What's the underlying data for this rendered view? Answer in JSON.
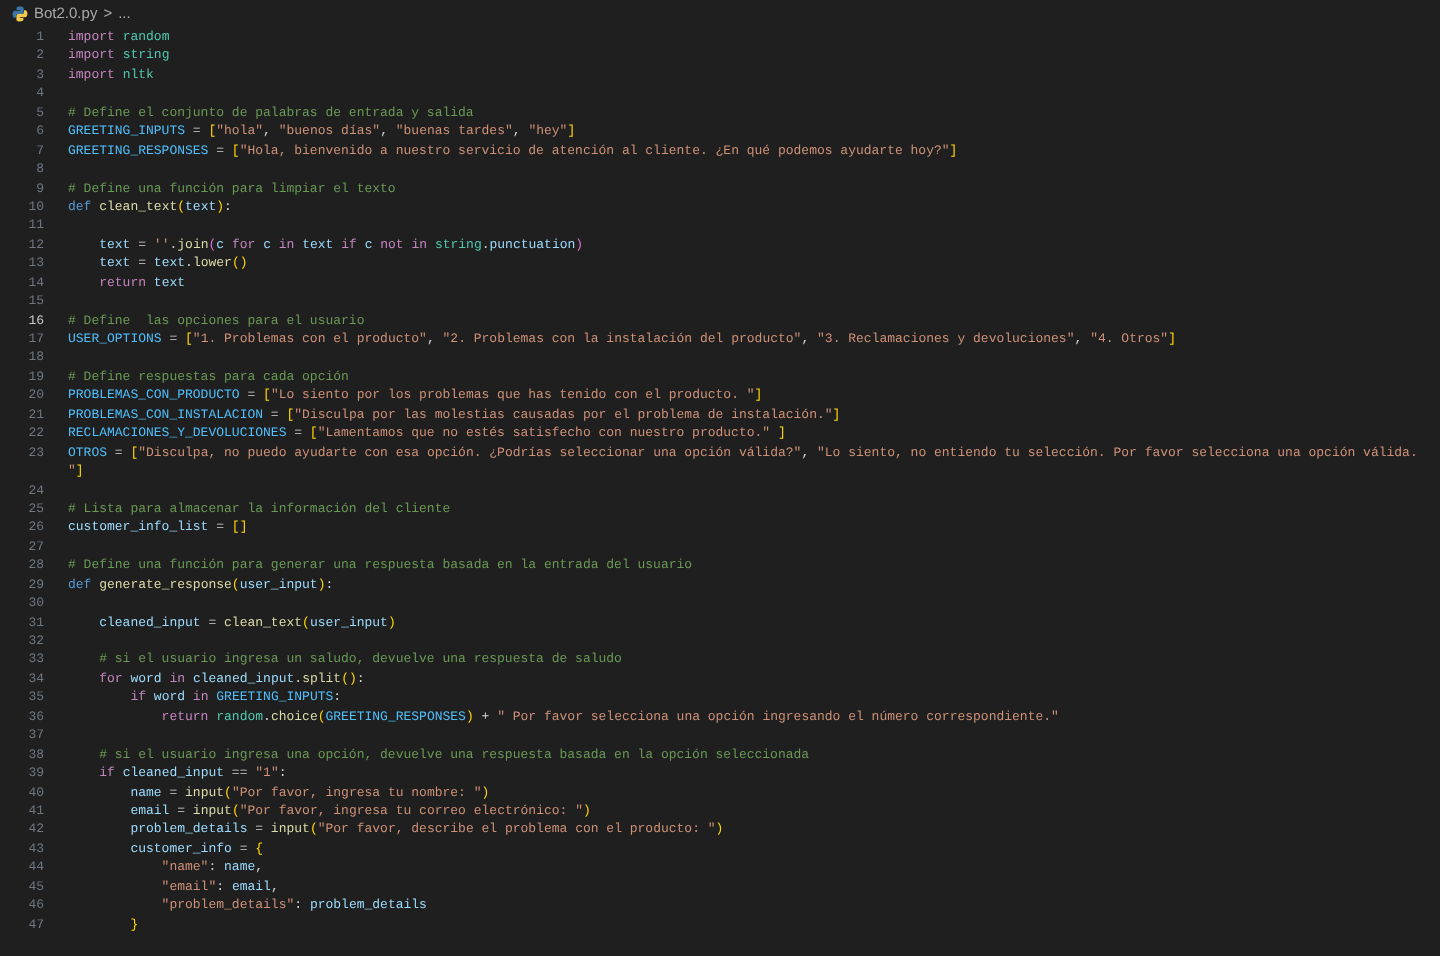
{
  "breadcrumb": {
    "file": "Bot2.0.py",
    "separator": ">",
    "more": "..."
  },
  "lines": [
    {
      "number": "1",
      "current": false,
      "tokens": [
        {
          "kind": "kw",
          "text": "import "
        },
        {
          "kind": "mod",
          "text": "random"
        }
      ]
    },
    {
      "number": "2",
      "current": false,
      "tokens": [
        {
          "kind": "kw",
          "text": "import "
        },
        {
          "kind": "mod",
          "text": "string"
        }
      ]
    },
    {
      "number": "3",
      "current": false,
      "tokens": [
        {
          "kind": "kw",
          "text": "import "
        },
        {
          "kind": "mod",
          "text": "nltk"
        }
      ]
    },
    {
      "number": "4",
      "current": false
    },
    {
      "number": "5",
      "current": false,
      "tokens": [
        {
          "kind": "com",
          "text": "# Define el conjunto de palabras de entrada y salida"
        }
      ]
    },
    {
      "number": "6",
      "current": false,
      "tokens": [
        {
          "kind": "const",
          "text": "GREETING_INPUTS"
        },
        {
          "kind": "op",
          "text": " = "
        },
        {
          "kind": "b1",
          "text": "["
        },
        {
          "kind": "str",
          "text": "\"hola\""
        },
        {
          "kind": "op",
          "text": ", "
        },
        {
          "kind": "str",
          "text": "\"buenos días\""
        },
        {
          "kind": "op",
          "text": ", "
        },
        {
          "kind": "str",
          "text": "\"buenas tardes\""
        },
        {
          "kind": "op",
          "text": ", "
        },
        {
          "kind": "str",
          "text": "\"hey\""
        },
        {
          "kind": "b1",
          "text": "]"
        }
      ]
    },
    {
      "number": "7",
      "current": false,
      "tokens": [
        {
          "kind": "const",
          "text": "GREETING_RESPONSES"
        },
        {
          "kind": "op",
          "text": " = "
        },
        {
          "kind": "b1",
          "text": "["
        },
        {
          "kind": "str",
          "text": "\"Hola, bienvenido a nuestro servicio de atención al cliente. ¿En qué podemos ayudarte hoy?\""
        },
        {
          "kind": "b1",
          "text": "]"
        }
      ]
    },
    {
      "number": "8",
      "current": false
    },
    {
      "number": "9",
      "current": false,
      "tokens": [
        {
          "kind": "com",
          "text": "# Define una función para limpiar el texto"
        }
      ]
    },
    {
      "number": "10",
      "current": false,
      "tokens": [
        {
          "kind": "def",
          "text": "def "
        },
        {
          "kind": "fn",
          "text": "clean_text"
        },
        {
          "kind": "b1",
          "text": "("
        },
        {
          "kind": "var",
          "text": "text"
        },
        {
          "kind": "b1",
          "text": ")"
        },
        {
          "kind": "op",
          "text": ":"
        }
      ]
    },
    {
      "number": "11",
      "current": false
    },
    {
      "number": "12",
      "current": false,
      "tokens": [
        {
          "kind": "var",
          "text": "    text"
        },
        {
          "kind": "op",
          "text": " = "
        },
        {
          "kind": "str",
          "text": "''"
        },
        {
          "kind": "op",
          "text": "."
        },
        {
          "kind": "fn",
          "text": "join"
        },
        {
          "kind": "b2",
          "text": "("
        },
        {
          "kind": "var",
          "text": "c"
        },
        {
          "kind": "kw",
          "text": " for "
        },
        {
          "kind": "var",
          "text": "c"
        },
        {
          "kind": "kw",
          "text": " in "
        },
        {
          "kind": "var",
          "text": "text"
        },
        {
          "kind": "kw",
          "text": " if "
        },
        {
          "kind": "var",
          "text": "c"
        },
        {
          "kind": "kw",
          "text": " not in "
        },
        {
          "kind": "mod",
          "text": "string"
        },
        {
          "kind": "op",
          "text": "."
        },
        {
          "kind": "var",
          "text": "punctuation"
        },
        {
          "kind": "b2",
          "text": ")"
        }
      ]
    },
    {
      "number": "13",
      "current": false,
      "tokens": [
        {
          "kind": "var",
          "text": "    text"
        },
        {
          "kind": "op",
          "text": " = "
        },
        {
          "kind": "var",
          "text": "text"
        },
        {
          "kind": "op",
          "text": "."
        },
        {
          "kind": "fn",
          "text": "lower"
        },
        {
          "kind": "b1",
          "text": "()"
        }
      ]
    },
    {
      "number": "14",
      "current": false,
      "tokens": [
        {
          "kind": "kw",
          "text": "    return "
        },
        {
          "kind": "var",
          "text": "text"
        }
      ]
    },
    {
      "number": "15",
      "current": false
    },
    {
      "number": "16",
      "current": true,
      "tokens": [
        {
          "kind": "com",
          "text": "# Define  las opciones para el usuario"
        }
      ]
    },
    {
      "number": "17",
      "current": false,
      "tokens": [
        {
          "kind": "const",
          "text": "USER_OPTIONS"
        },
        {
          "kind": "op",
          "text": " = "
        },
        {
          "kind": "b1",
          "text": "["
        },
        {
          "kind": "str",
          "text": "\"1. Problemas con el producto\""
        },
        {
          "kind": "op",
          "text": ", "
        },
        {
          "kind": "str",
          "text": "\"2. Problemas con la instalación del producto\""
        },
        {
          "kind": "op",
          "text": ", "
        },
        {
          "kind": "str",
          "text": "\"3. Reclamaciones y devoluciones\""
        },
        {
          "kind": "op",
          "text": ", "
        },
        {
          "kind": "str",
          "text": "\"4. Otros\""
        },
        {
          "kind": "b1",
          "text": "]"
        }
      ]
    },
    {
      "number": "18",
      "current": false
    },
    {
      "number": "19",
      "current": false,
      "tokens": [
        {
          "kind": "com",
          "text": "# Define respuestas para cada opción"
        }
      ]
    },
    {
      "number": "20",
      "current": false,
      "tokens": [
        {
          "kind": "const",
          "text": "PROBLEMAS_CON_PRODUCTO"
        },
        {
          "kind": "op",
          "text": " = "
        },
        {
          "kind": "b1",
          "text": "["
        },
        {
          "kind": "str",
          "text": "\"Lo siento por los problemas que has tenido con el producto. \""
        },
        {
          "kind": "b1",
          "text": "]"
        }
      ]
    },
    {
      "number": "21",
      "current": false,
      "tokens": [
        {
          "kind": "const",
          "text": "PROBLEMAS_CON_INSTALACION"
        },
        {
          "kind": "op",
          "text": " = "
        },
        {
          "kind": "b1",
          "text": "["
        },
        {
          "kind": "str",
          "text": "\"Disculpa por las molestias causadas por el problema de instalación.\""
        },
        {
          "kind": "b1",
          "text": "]"
        }
      ]
    },
    {
      "number": "22",
      "current": false,
      "tokens": [
        {
          "kind": "const",
          "text": "RECLAMACIONES_Y_DEVOLUCIONES"
        },
        {
          "kind": "op",
          "text": " = "
        },
        {
          "kind": "b1",
          "text": "["
        },
        {
          "kind": "str",
          "text": "\"Lamentamos que no estés satisfecho con nuestro producto.\" "
        },
        {
          "kind": "b1",
          "text": "]"
        }
      ]
    },
    {
      "number": "23",
      "current": false,
      "tokens": [
        {
          "kind": "const",
          "text": "OTROS"
        },
        {
          "kind": "op",
          "text": " = "
        },
        {
          "kind": "b1",
          "text": "["
        },
        {
          "kind": "str",
          "text": "\"Disculpa, no puedo ayudarte con esa opción. ¿Podrías seleccionar una opción válida?\""
        },
        {
          "kind": "op",
          "text": ", "
        },
        {
          "kind": "str",
          "text": "\"Lo siento, no entiendo tu selección. Por favor selecciona una opción válida."
        }
      ],
      "wrapped_tokens": [
        {
          "kind": "str",
          "text": "\""
        },
        {
          "kind": "b1",
          "text": "]"
        }
      ]
    },
    {
      "number": "24",
      "current": false
    },
    {
      "number": "25",
      "current": false,
      "tokens": [
        {
          "kind": "com",
          "text": "# Lista para almacenar la información del cliente"
        }
      ]
    },
    {
      "number": "26",
      "current": false,
      "tokens": [
        {
          "kind": "var",
          "text": "customer_info_list"
        },
        {
          "kind": "op",
          "text": " = "
        },
        {
          "kind": "b1",
          "text": "[]"
        }
      ]
    },
    {
      "number": "27",
      "current": false
    },
    {
      "number": "28",
      "current": false,
      "tokens": [
        {
          "kind": "com",
          "text": "# Define una función para generar una respuesta basada en la entrada del usuario"
        }
      ]
    },
    {
      "number": "29",
      "current": false,
      "tokens": [
        {
          "kind": "def",
          "text": "def "
        },
        {
          "kind": "fn",
          "text": "generate_response"
        },
        {
          "kind": "b1",
          "text": "("
        },
        {
          "kind": "var",
          "text": "user_input"
        },
        {
          "kind": "b1",
          "text": ")"
        },
        {
          "kind": "op",
          "text": ":"
        }
      ]
    },
    {
      "number": "30",
      "current": false
    },
    {
      "number": "31",
      "current": false,
      "tokens": [
        {
          "kind": "var",
          "text": "    cleaned_input"
        },
        {
          "kind": "op",
          "text": " = "
        },
        {
          "kind": "fn",
          "text": "clean_text"
        },
        {
          "kind": "b1",
          "text": "("
        },
        {
          "kind": "var",
          "text": "user_input"
        },
        {
          "kind": "b1",
          "text": ")"
        }
      ]
    },
    {
      "number": "32",
      "current": false
    },
    {
      "number": "33",
      "current": false,
      "tokens": [
        {
          "kind": "com",
          "text": "    # si el usuario ingresa un saludo, devuelve una respuesta de saludo"
        }
      ]
    },
    {
      "number": "34",
      "current": false,
      "tokens": [
        {
          "kind": "kw",
          "text": "    for "
        },
        {
          "kind": "var",
          "text": "word"
        },
        {
          "kind": "kw",
          "text": " in "
        },
        {
          "kind": "var",
          "text": "cleaned_input"
        },
        {
          "kind": "op",
          "text": "."
        },
        {
          "kind": "fn",
          "text": "split"
        },
        {
          "kind": "b1",
          "text": "()"
        },
        {
          "kind": "op",
          "text": ":"
        }
      ]
    },
    {
      "number": "35",
      "current": false,
      "tokens": [
        {
          "kind": "kw",
          "text": "        if "
        },
        {
          "kind": "var",
          "text": "word"
        },
        {
          "kind": "kw",
          "text": " in "
        },
        {
          "kind": "const",
          "text": "GREETING_INPUTS"
        },
        {
          "kind": "op",
          "text": ":"
        }
      ]
    },
    {
      "number": "36",
      "current": false,
      "tokens": [
        {
          "kind": "kw",
          "text": "            return "
        },
        {
          "kind": "mod",
          "text": "random"
        },
        {
          "kind": "op",
          "text": "."
        },
        {
          "kind": "fn",
          "text": "choice"
        },
        {
          "kind": "b1",
          "text": "("
        },
        {
          "kind": "const",
          "text": "GREETING_RESPONSES"
        },
        {
          "kind": "b1",
          "text": ")"
        },
        {
          "kind": "op",
          "text": " + "
        },
        {
          "kind": "str",
          "text": "\" Por favor selecciona una opción ingresando el número correspondiente.\""
        }
      ]
    },
    {
      "number": "37",
      "current": false
    },
    {
      "number": "38",
      "current": false,
      "tokens": [
        {
          "kind": "com",
          "text": "    # si el usuario ingresa una opción, devuelve una respuesta basada en la opción seleccionada"
        }
      ]
    },
    {
      "number": "39",
      "current": false,
      "tokens": [
        {
          "kind": "kw",
          "text": "    if "
        },
        {
          "kind": "var",
          "text": "cleaned_input"
        },
        {
          "kind": "op",
          "text": " == "
        },
        {
          "kind": "str",
          "text": "\"1\""
        },
        {
          "kind": "op",
          "text": ":"
        }
      ]
    },
    {
      "number": "40",
      "current": false,
      "tokens": [
        {
          "kind": "var",
          "text": "        name"
        },
        {
          "kind": "op",
          "text": " = "
        },
        {
          "kind": "fn",
          "text": "input"
        },
        {
          "kind": "b1",
          "text": "("
        },
        {
          "kind": "str",
          "text": "\"Por favor, ingresa tu nombre: \""
        },
        {
          "kind": "b1",
          "text": ")"
        }
      ]
    },
    {
      "number": "41",
      "current": false,
      "tokens": [
        {
          "kind": "var",
          "text": "        email"
        },
        {
          "kind": "op",
          "text": " = "
        },
        {
          "kind": "fn",
          "text": "input"
        },
        {
          "kind": "b1",
          "text": "("
        },
        {
          "kind": "str",
          "text": "\"Por favor, ingresa tu correo electrónico: \""
        },
        {
          "kind": "b1",
          "text": ")"
        }
      ]
    },
    {
      "number": "42",
      "current": false,
      "tokens": [
        {
          "kind": "var",
          "text": "        problem_details"
        },
        {
          "kind": "op",
          "text": " = "
        },
        {
          "kind": "fn",
          "text": "input"
        },
        {
          "kind": "b1",
          "text": "("
        },
        {
          "kind": "str",
          "text": "\"Por favor, describe el problema con el producto: \""
        },
        {
          "kind": "b1",
          "text": ")"
        }
      ]
    },
    {
      "number": "43",
      "current": false,
      "tokens": [
        {
          "kind": "var",
          "text": "        customer_info"
        },
        {
          "kind": "op",
          "text": " = "
        },
        {
          "kind": "b1",
          "text": "{"
        }
      ]
    },
    {
      "number": "44",
      "current": false,
      "tokens": [
        {
          "kind": "str",
          "text": "            \"name\""
        },
        {
          "kind": "op",
          "text": ": "
        },
        {
          "kind": "var",
          "text": "name"
        },
        {
          "kind": "op",
          "text": ","
        }
      ]
    },
    {
      "number": "45",
      "current": false,
      "tokens": [
        {
          "kind": "str",
          "text": "            \"email\""
        },
        {
          "kind": "op",
          "text": ": "
        },
        {
          "kind": "var",
          "text": "email"
        },
        {
          "kind": "op",
          "text": ","
        }
      ]
    },
    {
      "number": "46",
      "current": false,
      "tokens": [
        {
          "kind": "str",
          "text": "            \"problem_details\""
        },
        {
          "kind": "op",
          "text": ": "
        },
        {
          "kind": "var",
          "text": "problem_details"
        }
      ]
    },
    {
      "number": "47",
      "current": false,
      "tokens": [
        {
          "kind": "b1",
          "text": "        }"
        }
      ]
    }
  ]
}
